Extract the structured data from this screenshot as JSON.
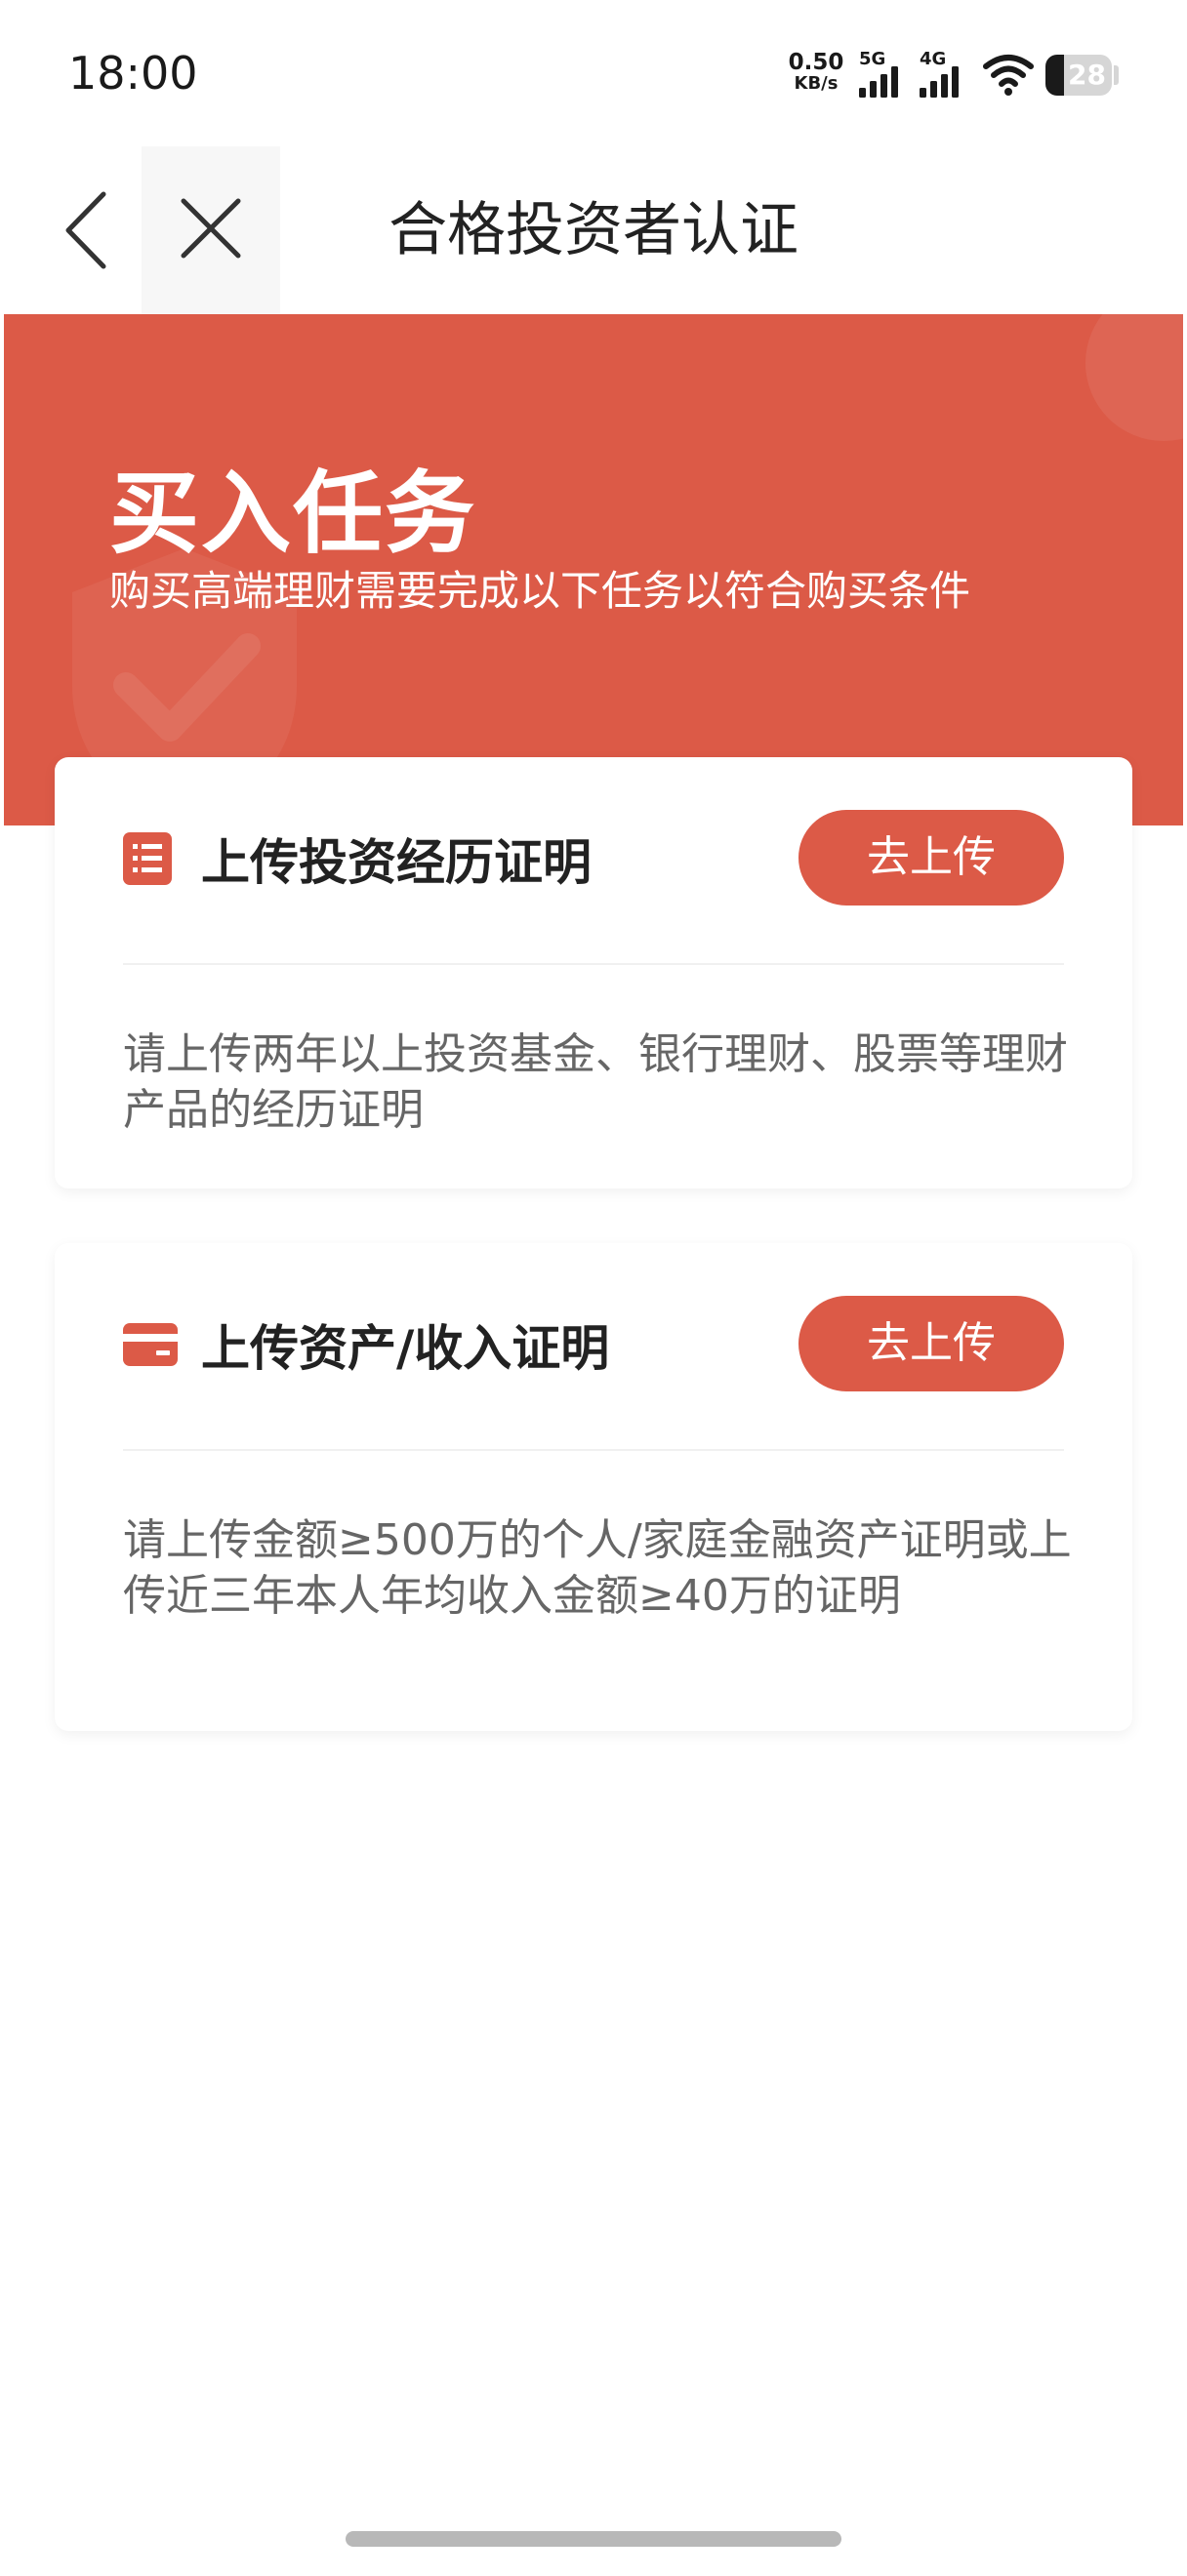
{
  "status_bar": {
    "time": "18:00",
    "net_speed_value": "0.50",
    "net_speed_unit": "KB/s",
    "signal_1_label": "5G",
    "signal_2_label": "4G",
    "battery_level": "28",
    "icons": [
      "signal-5g-icon",
      "signal-4g-icon",
      "wifi-icon",
      "battery-icon"
    ]
  },
  "nav": {
    "title": "合格投资者认证",
    "icons": [
      "back-chevron-icon",
      "close-icon"
    ]
  },
  "hero": {
    "title": "买入任务",
    "subtitle": "购买高端理财需要完成以下任务以符合购买条件"
  },
  "tasks": [
    {
      "title": "上传投资经历证明",
      "button": "去上传",
      "description": "请上传两年以上投资基金、银行理财、股票等理财产品的经历证明",
      "icon": "document-list-icon"
    },
    {
      "title": "上传资产/收入证明",
      "button": "去上传",
      "description": "请上传金额≥500万的个人/家庭金融资产证明或上传近三年本人年均收入金额≥40万的证明",
      "icon": "credit-card-icon"
    }
  ],
  "colors": {
    "accent": "#dc5a47",
    "text_primary": "#222222",
    "text_secondary": "#666666",
    "background": "#ffffff"
  }
}
